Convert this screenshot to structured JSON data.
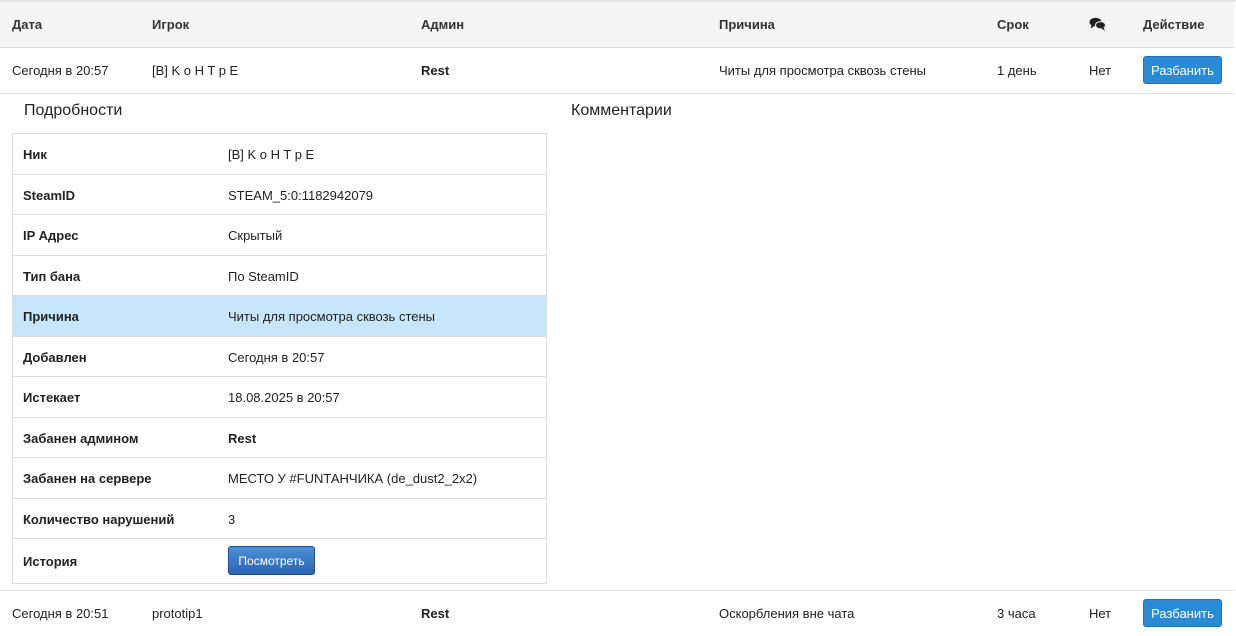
{
  "header": {
    "date": "Дата",
    "player": "Игрок",
    "admin": "Админ",
    "reason": "Причина",
    "term": "Срок",
    "comments_icon": "comments-icon",
    "action": "Действие"
  },
  "bans": [
    {
      "date": "Сегодня в 20:57",
      "player": "[B] K o H T p E",
      "admin": "Rest",
      "reason": "Читы для просмотра сквозь стены",
      "term": "1 день",
      "comments": "Нет",
      "action_label": "Разбанить"
    },
    {
      "date": "Сегодня в 20:51",
      "player": "prototip1",
      "admin": "Rest",
      "reason": "Оскорбления вне чата",
      "term": "3 часа",
      "comments": "Нет",
      "action_label": "Разбанить"
    }
  ],
  "details": {
    "title": "Подробности",
    "rows": [
      {
        "label": "Ник",
        "value": "[B] K o H T p E"
      },
      {
        "label": "SteamID",
        "value": "STEAM_5:0:1182942079"
      },
      {
        "label": "IP Адрес",
        "value": "Скрытый"
      },
      {
        "label": "Тип бана",
        "value": "По SteamID"
      },
      {
        "label": "Причина",
        "value": "Читы для просмотра сквозь стены"
      },
      {
        "label": "Добавлен",
        "value": "Сегодня в 20:57"
      },
      {
        "label": "Истекает",
        "value": "18.08.2025 в 20:57"
      },
      {
        "label": "Забанен админом",
        "value": "Rest"
      },
      {
        "label": "Забанен на сервере",
        "value": "МЕСТО У #FUNТАНЧИКА (de_dust2_2x2)"
      },
      {
        "label": "Количество нарушений",
        "value": "3"
      },
      {
        "label": "История",
        "button_label": "Посмотреть"
      }
    ]
  },
  "comments": {
    "title": "Комментарии"
  },
  "colors": {
    "accent": "#2a8ad4",
    "highlight_row": "#c7e6fb",
    "header_bg": "#f5f5f5"
  }
}
